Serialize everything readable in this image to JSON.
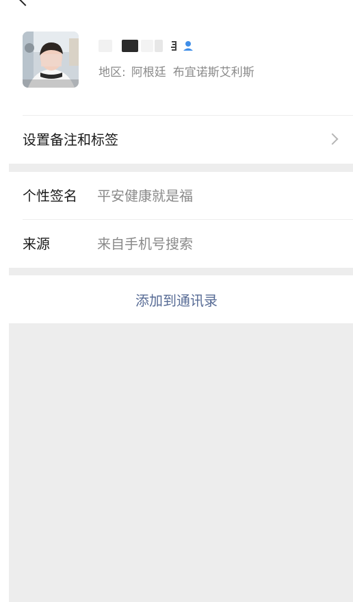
{
  "profile": {
    "region_label": "地区:",
    "region_country": "阿根廷",
    "region_city": "布宜诺斯艾利斯"
  },
  "remark_row": {
    "label": "设置备注和标签"
  },
  "signature_row": {
    "label": "个性签名",
    "value": "平安健康就是福"
  },
  "source_row": {
    "label": "来源",
    "value": "来自手机号搜索"
  },
  "action": {
    "add_contact_label": "添加到通讯录"
  },
  "colors": {
    "link": "#576b95",
    "secondary_text": "#8a8a8a",
    "background_gray": "#ededed",
    "verified_blue": "#3f8ee8"
  }
}
